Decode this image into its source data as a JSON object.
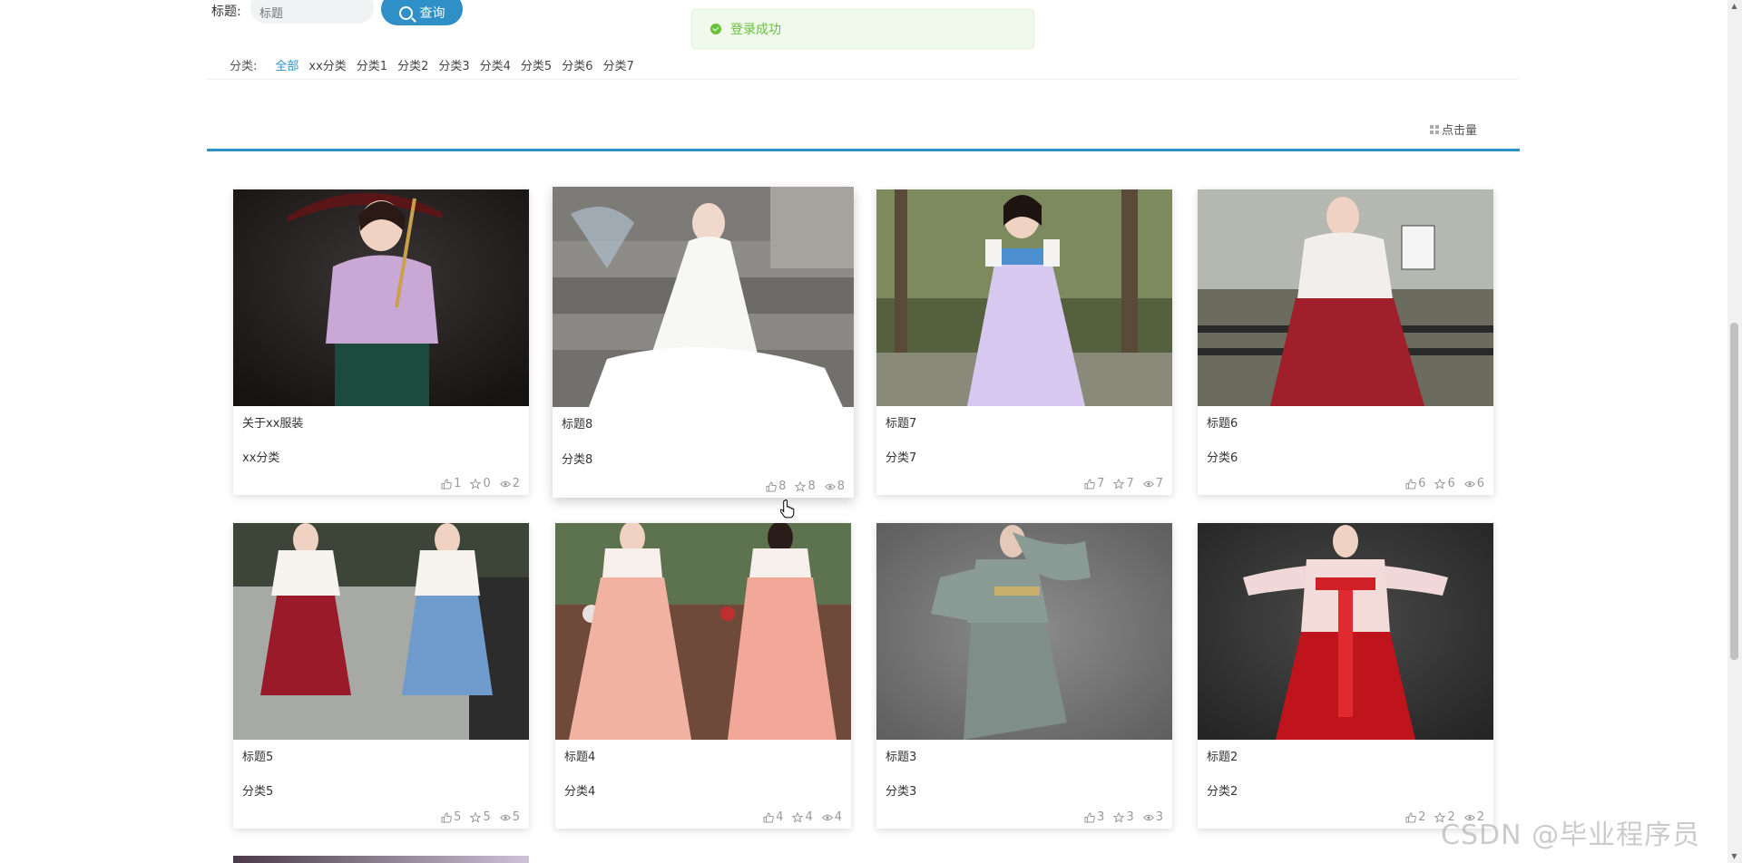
{
  "search": {
    "label": "标题:",
    "placeholder": "标题",
    "button_label": "查询"
  },
  "toast": {
    "message": "登录成功",
    "color": "#67c23a"
  },
  "categories": {
    "label": "分类:",
    "items": [
      "全部",
      "xx分类",
      "分类1",
      "分类2",
      "分类3",
      "分类4",
      "分类5",
      "分类6",
      "分类7"
    ],
    "active_index": 0
  },
  "sort": {
    "label": "点击量"
  },
  "accent_color": "#2f8fc7",
  "cards": [
    {
      "title": "关于xx服装",
      "category": "xx分类",
      "likes": "1",
      "favorites": "0",
      "views": "2"
    },
    {
      "title": "标题8",
      "category": "分类8",
      "likes": "8",
      "favorites": "8",
      "views": "8"
    },
    {
      "title": "标题7",
      "category": "分类7",
      "likes": "7",
      "favorites": "7",
      "views": "7"
    },
    {
      "title": "标题6",
      "category": "分类6",
      "likes": "6",
      "favorites": "6",
      "views": "6"
    },
    {
      "title": "标题5",
      "category": "分类5",
      "likes": "5",
      "favorites": "5",
      "views": "5"
    },
    {
      "title": "标题4",
      "category": "分类4",
      "likes": "4",
      "favorites": "4",
      "views": "4"
    },
    {
      "title": "标题3",
      "category": "分类3",
      "likes": "3",
      "favorites": "3",
      "views": "3"
    },
    {
      "title": "标题2",
      "category": "分类2",
      "likes": "2",
      "favorites": "2",
      "views": "2"
    }
  ],
  "watermark": "CSDN @毕业程序员"
}
